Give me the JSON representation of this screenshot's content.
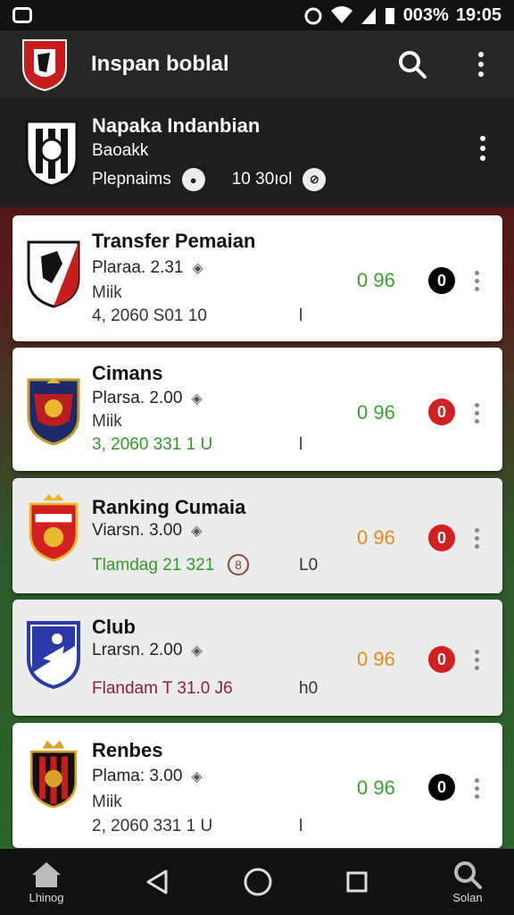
{
  "status_bar": {
    "battery_text": "003%",
    "time": "19:05"
  },
  "app_bar": {
    "title": "Inspan boblal"
  },
  "header": {
    "name": "Napaka Indanbian",
    "subtitle": "Baoakk",
    "stat_label": "Plepnaims",
    "stat_value": "10 30ıol"
  },
  "cards": [
    {
      "title": "Transfer Pemaian",
      "line1": "Plaraa. 2.31",
      "line2": "Miik",
      "line3": "4, 2060 S01 10",
      "line3_end": "l",
      "score": "0 96",
      "score_color": "#3aa22e",
      "pill": "0",
      "pill_color": "#000000",
      "line3_color": "#333333",
      "variant": "white"
    },
    {
      "title": "Cimans",
      "line1": "Plarsa. 2.00",
      "line2": "Miik",
      "line3": "3, 2060 331 1 U",
      "line3_end": "l",
      "score": "0 96",
      "score_color": "#3aa22e",
      "pill": "0",
      "pill_color": "#d31f1f",
      "line3_color": "#2f9a27",
      "variant": "white"
    },
    {
      "title": "Ranking Cumaia",
      "line1": "Viarsn. 3.00",
      "line2": "",
      "line3": "Tlamdag 21 321",
      "line3_end": "L0",
      "score": "0 96",
      "score_color": "#e38a1a",
      "pill": "0",
      "pill_color": "#d31f1f",
      "line3_color": "#2f9a27",
      "variant": "grey"
    },
    {
      "title": "Club",
      "line1": "Lrarsn. 2.00",
      "line2": "",
      "line3": "Flandam T 31.0 J6",
      "line3_end": "h0",
      "score": "0 96",
      "score_color": "#e38a1a",
      "pill": "0",
      "pill_color": "#d31f1f",
      "line3_color": "#8a2040",
      "variant": "grey"
    },
    {
      "title": "Renbes",
      "line1": "Plama: 3.00",
      "line2": "Miik",
      "line3": "2, 2060 331 1 U",
      "line3_end": "l",
      "score": "0 96",
      "score_color": "#3aa22e",
      "pill": "0",
      "pill_color": "#000000",
      "line3_color": "#333333",
      "variant": "white"
    }
  ],
  "nav": {
    "home_label": "Lhinog",
    "search_label": "Solan"
  },
  "colors": {
    "green": "#3aa22e",
    "orange": "#e38a1a",
    "red": "#d31f1f"
  }
}
